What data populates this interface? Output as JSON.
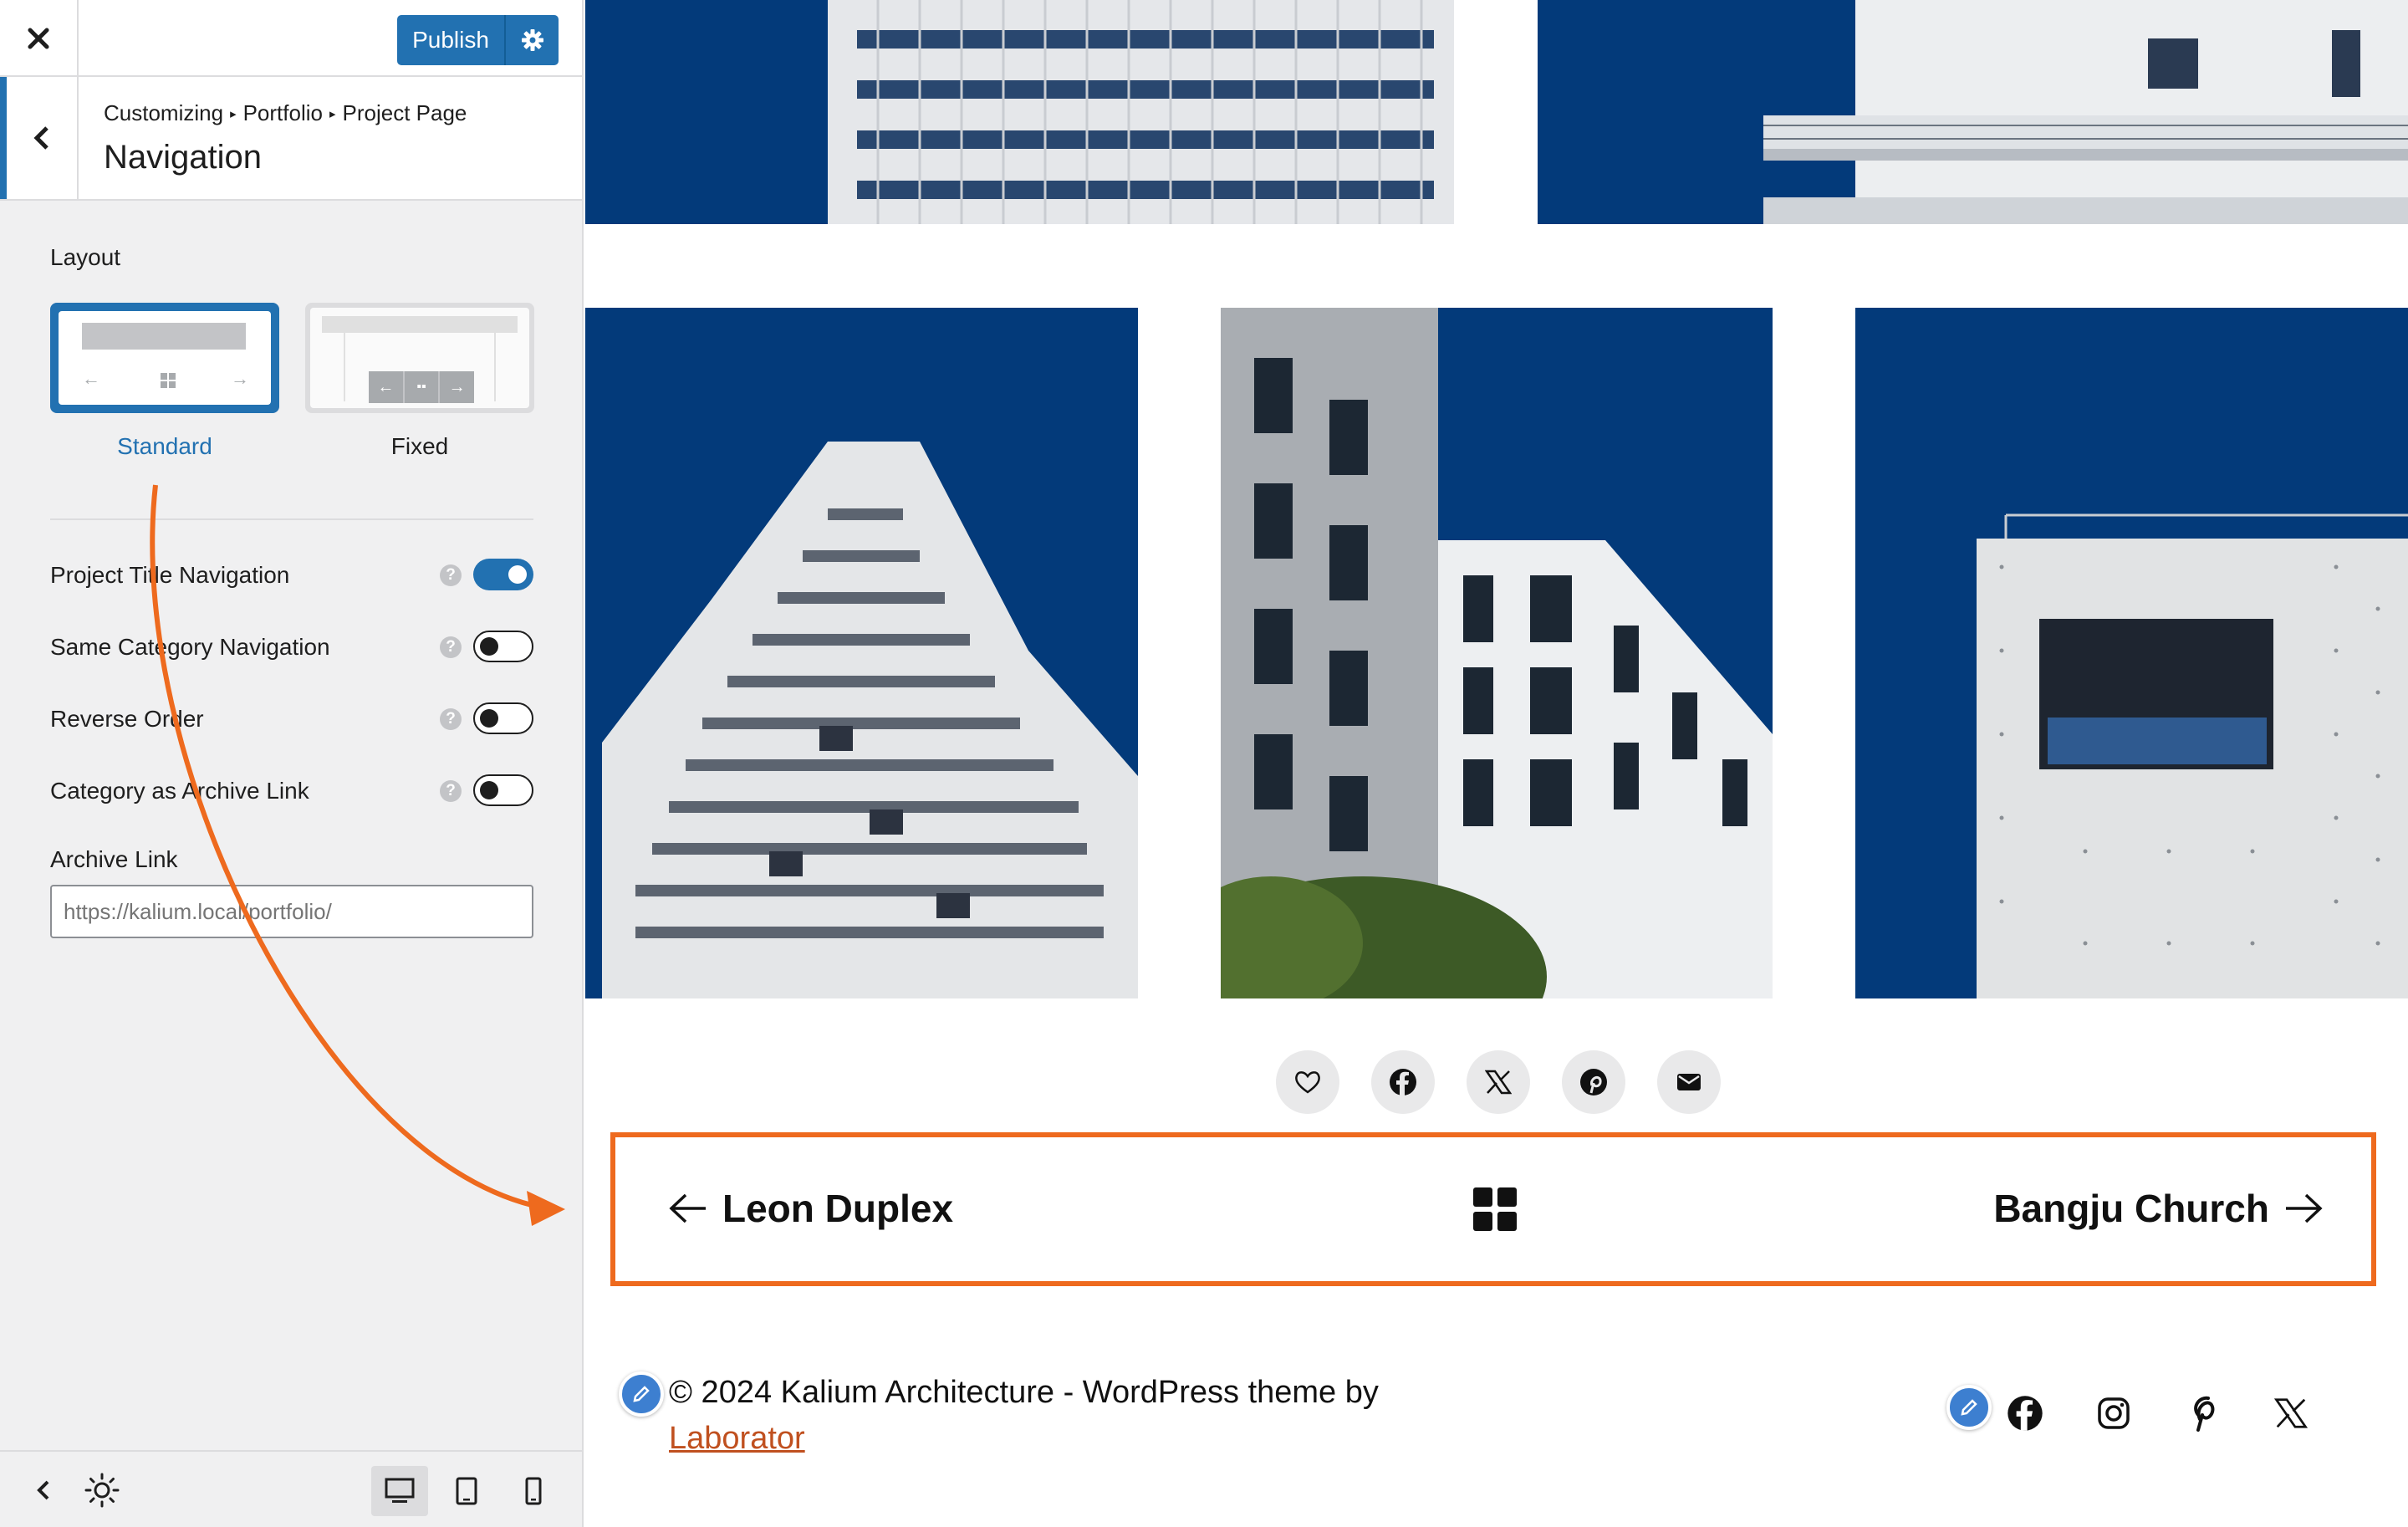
{
  "topbar": {
    "close_label": "Close",
    "publish_label": "Publish"
  },
  "section": {
    "breadcrumb": [
      "Customizing",
      "Portfolio",
      "Project Page"
    ],
    "title": "Navigation"
  },
  "layout": {
    "label": "Layout",
    "options": [
      {
        "label": "Standard",
        "selected": true
      },
      {
        "label": "Fixed",
        "selected": false
      }
    ]
  },
  "toggles": [
    {
      "label": "Project Title Navigation",
      "on": true
    },
    {
      "label": "Same Category Navigation",
      "on": false
    },
    {
      "label": "Reverse Order",
      "on": false
    },
    {
      "label": "Category as Archive Link",
      "on": false
    }
  ],
  "archive_link": {
    "label": "Archive Link",
    "placeholder": "https://kalium.local/portfolio/"
  },
  "preview": {
    "share_icons": [
      "heart-icon",
      "facebook-icon",
      "x-icon",
      "pinterest-icon",
      "email-icon"
    ],
    "prev_project": "Leon Duplex",
    "next_project": "Bangju Church",
    "copyright_text": "© 2024 Kalium Architecture - WordPress theme by",
    "copyright_link": "Laborator",
    "social_icons": [
      "facebook-icon",
      "instagram-icon",
      "pinterest-icon",
      "x-icon"
    ]
  },
  "colors": {
    "accent": "#2271b1",
    "highlight": "#ee6a1e",
    "tile_background": "#033a7a"
  }
}
